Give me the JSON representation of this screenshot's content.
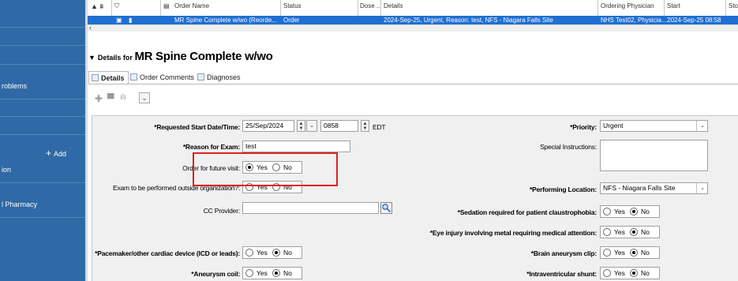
{
  "nav": {
    "items": [
      "roblems",
      "ion",
      "l Pharmacy"
    ],
    "add_label": "Add"
  },
  "grid": {
    "headers": [
      "Order Name",
      "Status",
      "Dose ...",
      "Details",
      "Ordering Physician",
      "Start",
      "Sto"
    ],
    "row": {
      "order_name": "MR Spine Complete w/wo (Reorde...",
      "status": "Order",
      "details": "2024-Sep-25, Urgent, Reason: test, NFS - Niagara Falls Site",
      "physician": "NHS Test02, Physicia...",
      "start": "2024-Sep-25 08:58"
    }
  },
  "details": {
    "prefix": "Details for",
    "title": "MR Spine Complete w/wo",
    "tabs": [
      "Details",
      "Order Comments",
      "Diagnoses"
    ]
  },
  "form": {
    "start_label": "*Requested Start Date/Time:",
    "start_date": "25/Sep/2024",
    "start_time": "0858",
    "timezone": "EDT",
    "reason_label": "*Reason for Exam:",
    "reason_value": "test",
    "future_label": "Order for future visit:",
    "outside_label": "Exam to be performed outside organization?:",
    "cc_label": "CC Provider:",
    "pacemaker_label": "*Pacemaker/other cardiac device (ICD or leads):",
    "aneurysm_coil_label": "*Aneurysm coil:",
    "priority_label": "*Priority:",
    "priority_value": "Urgent",
    "special_label": "Special Instructions:",
    "location_label": "*Performing Location:",
    "location_value": "NFS - Niagara Falls Site",
    "sedation_label": "*Sedation required for patient claustrophobia:",
    "eye_label": "*Eye injury involving metal requiring medical attention:",
    "brain_label": "*Brain aneurysm clip:",
    "shunt_label": "*Intraventricular shunt:",
    "yes": "Yes",
    "no": "No"
  },
  "colors": {
    "nav_bg": "#2f6aa6",
    "selection": "#1f6fd1",
    "highlight": "#e02020"
  }
}
